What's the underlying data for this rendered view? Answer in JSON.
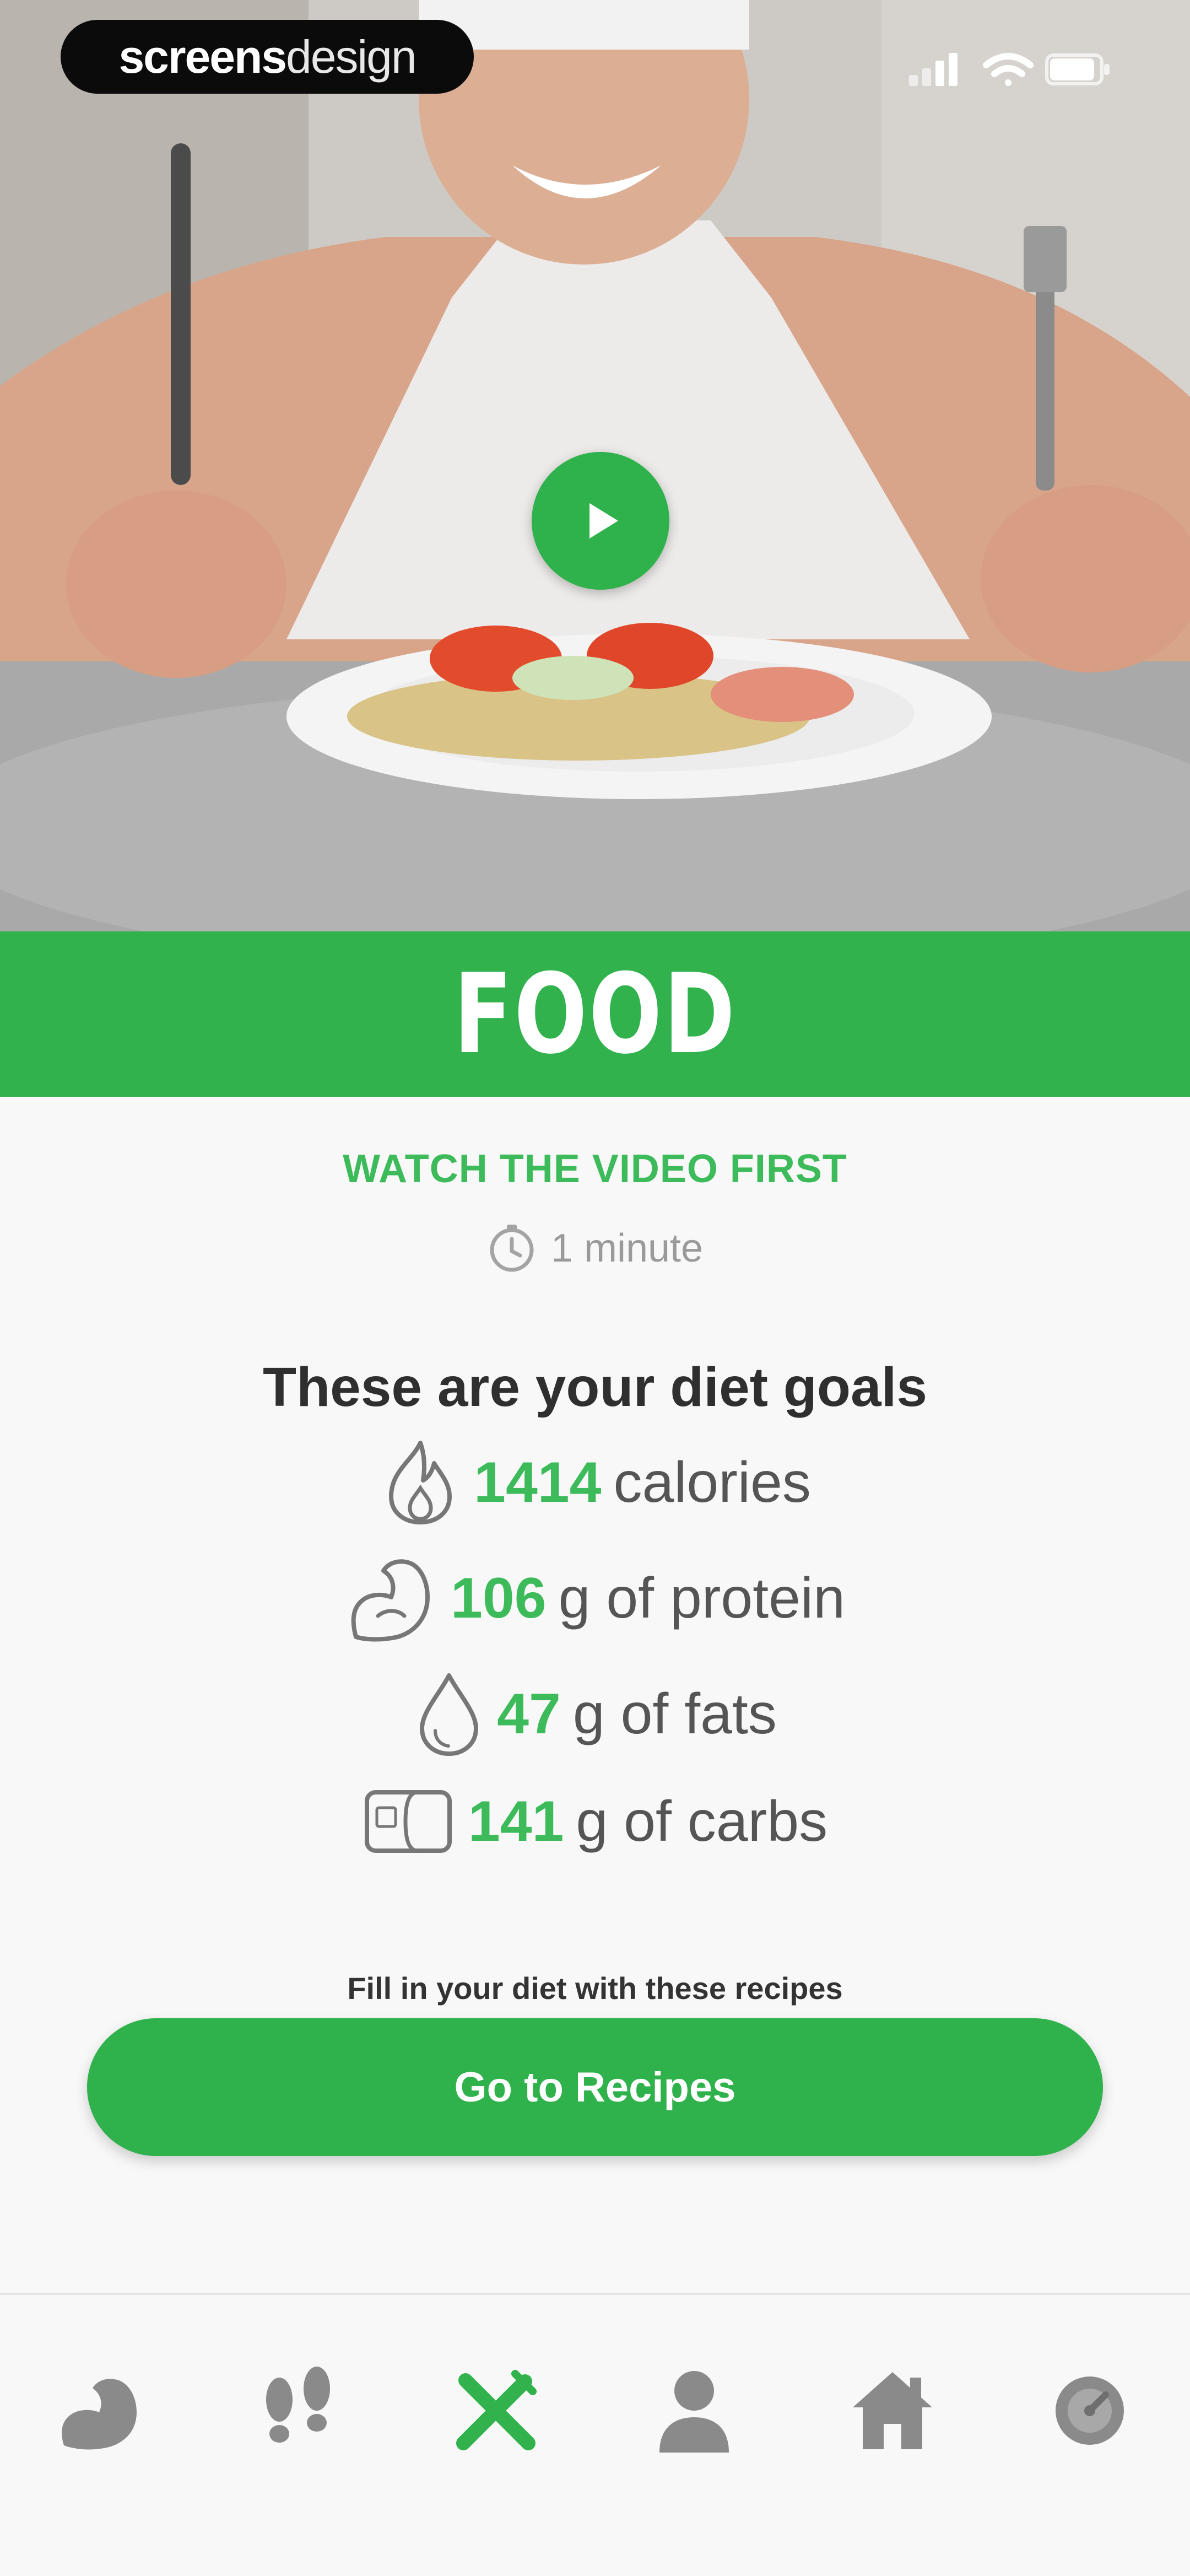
{
  "watermark": {
    "bold": "screens",
    "light": "design"
  },
  "hero": {
    "play_icon": "play-icon"
  },
  "title": "FOOD",
  "watch_label": "WATCH THE VIDEO FIRST",
  "duration": {
    "icon": "clock-icon",
    "text": "1 minute"
  },
  "goals": {
    "heading": "These are your diet goals",
    "items": [
      {
        "icon": "flame-icon",
        "value": "1414",
        "label": " calories"
      },
      {
        "icon": "bicep-icon",
        "value": "106",
        "label": "g of protein"
      },
      {
        "icon": "drop-icon",
        "value": "47",
        "label": "g of fats"
      },
      {
        "icon": "bread-icon",
        "value": "141",
        "label": "g of carbs"
      }
    ]
  },
  "fill_in_text": "Fill in your diet with these recipes",
  "recipes_button_label": "Go to Recipes",
  "nav": {
    "items": [
      {
        "icon": "bicep-icon",
        "active": false
      },
      {
        "icon": "footprints-icon",
        "active": false
      },
      {
        "icon": "fork-knife-icon",
        "active": true
      },
      {
        "icon": "person-icon",
        "active": false
      },
      {
        "icon": "home-icon",
        "active": false
      },
      {
        "icon": "speedometer-icon",
        "active": false
      }
    ]
  },
  "colors": {
    "accent": "#31b24d",
    "text": "#555555",
    "inactive_icon": "#8a8a8a"
  }
}
